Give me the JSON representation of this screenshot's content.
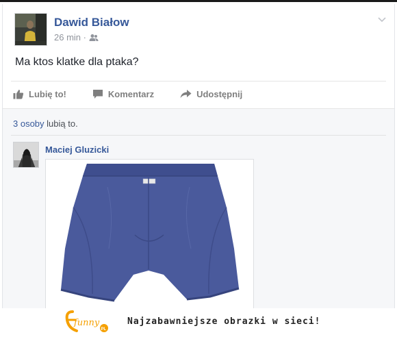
{
  "post": {
    "author": "Dawid Białow",
    "time": "26 min ·",
    "audience_icon": "friends-icon",
    "text": "Ma ktos klatke dla ptaka?"
  },
  "actions": {
    "like": "Lubię to!",
    "comment": "Komentarz",
    "share": "Udostępnij"
  },
  "likes": {
    "count_link": "3 osoby",
    "suffix": " lubią to."
  },
  "comment": {
    "author": "Maciej Gluzicki",
    "image": "blue-boxer-shorts-photo"
  },
  "footer": {
    "tagline": "Najzabawniejsze obrazki w sieci!",
    "logo_text": "funny",
    "logo_badge": "PL"
  },
  "colors": {
    "link": "#365899",
    "muted": "#90949c",
    "action": "#7f7f7f",
    "feedback_bg": "#f6f7f9",
    "shorts": "#4a5a9c"
  }
}
